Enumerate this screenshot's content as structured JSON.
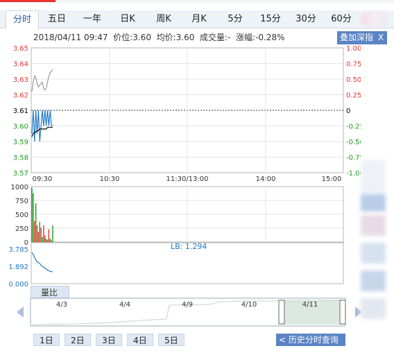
{
  "tabs": [
    "分时",
    "五日",
    "一年",
    "日K",
    "周K",
    "月K",
    "5分",
    "15分",
    "30分",
    "60分"
  ],
  "info": {
    "datetime": "2018/04/11 09:47",
    "price_label": "价位:3.60",
    "avg_label": "均价:3.60",
    "volume_label": "成交量:-",
    "change_label": "涨幅:-0.28%"
  },
  "overlay_button": {
    "label": "叠加深指",
    "close": "X"
  },
  "volume_tab_label": "量比",
  "range_buttons": [
    "1日",
    "2日",
    "3日",
    "4日",
    "5日"
  ],
  "history_button": "< 历史分时查询",
  "colors": {
    "price_line": "#1f78c8",
    "avg_line": "#000000",
    "index_line": "#999999",
    "up": "#e8322b",
    "down": "#1a9a1a",
    "axis_left_up": "#e8322b",
    "axis_left_flat": "#000000",
    "axis_left_down": "#1a9a1a",
    "panel_button": "#5b84c4"
  },
  "chart_data": [
    {
      "type": "line",
      "title": "",
      "xlabel": "",
      "ylabel": "",
      "x_ticks": [
        "09:30",
        "10:30",
        "11:30/13:00",
        "14:00",
        "15:00"
      ],
      "y_ticks_left": [
        "3.65",
        "3.64",
        "3.63",
        "3.62",
        "3.61",
        "3.60",
        "3.59",
        "3.58",
        "3.57"
      ],
      "y_ticks_right": [
        "1.00%",
        "0.75%",
        "0.50%",
        "0.25%",
        "0",
        "-0.25%",
        "-0.50%",
        "-0.75%",
        "-1.00%"
      ],
      "ylim": [
        3.57,
        3.65
      ],
      "prev_close": 3.61,
      "series": [
        {
          "values": [
            3.595,
            3.61,
            3.59,
            3.61,
            3.595,
            3.61,
            3.59,
            3.6,
            3.61,
            3.6,
            3.61,
            3.6,
            3.61,
            3.6,
            3.61,
            3.6,
            3.6
          ]
        },
        {
          "values": [
            3.593,
            3.595,
            3.596,
            3.596,
            3.597,
            3.597,
            3.598,
            3.598,
            3.598,
            3.598,
            3.598,
            3.598,
            3.599,
            3.599,
            3.599,
            3.599,
            3.599
          ]
        },
        {
          "values": [
            3.622,
            3.628,
            3.632,
            3.631,
            3.627,
            3.625,
            3.626,
            3.627,
            3.628,
            3.624,
            3.623,
            3.624,
            3.628,
            3.632,
            3.634,
            3.635,
            3.636
          ]
        }
      ]
    },
    {
      "type": "bar",
      "y_ticks": [
        "1000",
        "750",
        "500",
        "250",
        "0"
      ],
      "ylim": [
        0,
        1000
      ],
      "values": [
        980,
        880,
        380,
        700,
        300,
        180,
        360,
        260,
        90,
        300,
        120,
        60,
        40,
        230,
        60,
        30,
        300
      ],
      "colors": [
        "down",
        "down",
        "up",
        "down",
        "up",
        "up",
        "down",
        "up",
        "down",
        "up",
        "up",
        "down",
        "up",
        "up",
        "down",
        "up",
        "down"
      ]
    },
    {
      "type": "line",
      "label": "LB: 1.294",
      "y_ticks": [
        "3.785",
        "1.892",
        "0.000"
      ],
      "ylim": [
        0,
        3.785
      ],
      "values": [
        3.4,
        3.2,
        2.9,
        2.6,
        2.4,
        2.3,
        2.2,
        2.0,
        1.9,
        1.8,
        1.7,
        1.6,
        1.5,
        1.4,
        1.35,
        1.3,
        1.294
      ]
    }
  ],
  "navigator": {
    "dates": [
      "4/3",
      "4/4",
      "4/9",
      "4/10",
      "4/11"
    ]
  }
}
